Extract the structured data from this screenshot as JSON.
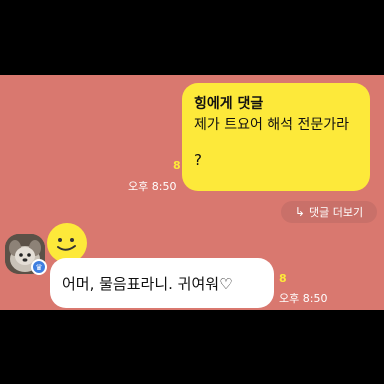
{
  "colors": {
    "chat_background": "#d9786f",
    "my_bubble": "#fde93a",
    "other_bubble": "#ffffff",
    "unread_count": "#fde93a",
    "frame": "#000000"
  },
  "my_message": {
    "reply_title": "힝에게 댓글",
    "text": "제가 트요어 해석 전문가라",
    "question": "?",
    "unread_count": "8",
    "time": "오후 8:50",
    "reply_button_icon": "reply-arrow-icon",
    "reply_button_arrow": "↳",
    "reply_button_label": "댓글 더보기"
  },
  "other_message": {
    "avatar_icon": "profile-avatar",
    "badge_icon": "crown-badge-icon",
    "badge_symbol": "♛",
    "sticker_icon": "smiley-sticker",
    "text": "어머, 물음표라니. 귀여워♡",
    "unread_count": "8",
    "time": "오후 8:50"
  }
}
